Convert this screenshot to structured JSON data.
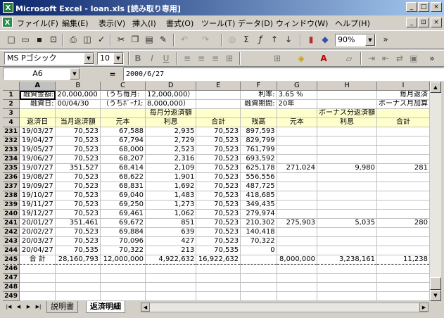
{
  "window": {
    "title": "Microsoft Excel - loan.xls  [読み取り専用]",
    "controls": [
      "_",
      "□",
      "×"
    ],
    "doc_controls": [
      "_",
      "⊡",
      "×"
    ]
  },
  "menu": [
    "ファイル(F)",
    "編集(E)",
    "表示(V)",
    "挿入(I)",
    "書式(O)",
    "ツール(T)",
    "データ(D)",
    "ウィンドウ(W)",
    "ヘルプ(H)"
  ],
  "toolbar": {
    "zoom": "90%",
    "font_name": "MS Pゴシック",
    "font_size": "10"
  },
  "formula": {
    "name_box": "A6",
    "equals": "=",
    "content": "2000/6/27"
  },
  "columns": [
    "",
    "A",
    "B",
    "C",
    "D",
    "E",
    "F",
    "G",
    "H",
    "I"
  ],
  "rows": [
    {
      "n": "1",
      "cells": [
        "融資金額:",
        "20,000,000",
        "（うち毎月:",
        "12,000,000）",
        "",
        "利率:",
        "3.65 %",
        "",
        "毎月返済"
      ]
    },
    {
      "n": "2",
      "cells": [
        "融資日:",
        "00/04/30",
        "（うちﾎﾞｰﾅｽ:",
        "8,000,000）",
        "",
        "融資期間:",
        "20年",
        "",
        "ボーナス月加算"
      ]
    },
    {
      "n": "3",
      "cells": [
        "",
        "",
        "",
        "毎月分返済額",
        "",
        "",
        "",
        "ボーナス分返済額",
        ""
      ]
    },
    {
      "n": "4",
      "cells": [
        "返済日",
        "当月返済額",
        "元本",
        "利息",
        "合計",
        "残高",
        "元本",
        "利息",
        "合計"
      ]
    },
    {
      "n": "231",
      "cells": [
        "19/03/27",
        "70,523",
        "67,588",
        "2,935",
        "70,523",
        "897,593",
        "",
        "",
        ""
      ]
    },
    {
      "n": "232",
      "cells": [
        "19/04/27",
        "70,523",
        "67,794",
        "2,729",
        "70,523",
        "829,799",
        "",
        "",
        ""
      ]
    },
    {
      "n": "233",
      "cells": [
        "19/05/27",
        "70,523",
        "68,000",
        "2,523",
        "70,523",
        "761,799",
        "",
        "",
        ""
      ]
    },
    {
      "n": "234",
      "cells": [
        "19/06/27",
        "70,523",
        "68,207",
        "2,316",
        "70,523",
        "693,592",
        "",
        "",
        ""
      ]
    },
    {
      "n": "235",
      "cells": [
        "19/07/27",
        "351,527",
        "68,414",
        "2,109",
        "70,523",
        "625,178",
        "271,024",
        "9,980",
        "281"
      ]
    },
    {
      "n": "236",
      "cells": [
        "19/08/27",
        "70,523",
        "68,622",
        "1,901",
        "70,523",
        "556,556",
        "",
        "",
        ""
      ]
    },
    {
      "n": "237",
      "cells": [
        "19/09/27",
        "70,523",
        "68,831",
        "1,692",
        "70,523",
        "487,725",
        "",
        "",
        ""
      ]
    },
    {
      "n": "238",
      "cells": [
        "19/10/27",
        "70,523",
        "69,040",
        "1,483",
        "70,523",
        "418,685",
        "",
        "",
        ""
      ]
    },
    {
      "n": "239",
      "cells": [
        "19/11/27",
        "70,523",
        "69,250",
        "1,273",
        "70,523",
        "349,435",
        "",
        "",
        ""
      ]
    },
    {
      "n": "240",
      "cells": [
        "19/12/27",
        "70,523",
        "69,461",
        "1,062",
        "70,523",
        "279,974",
        "",
        "",
        ""
      ]
    },
    {
      "n": "241",
      "cells": [
        "20/01/27",
        "351,461",
        "69,672",
        "851",
        "70,523",
        "210,302",
        "275,903",
        "5,035",
        "280"
      ]
    },
    {
      "n": "242",
      "cells": [
        "20/02/27",
        "70,523",
        "69,884",
        "639",
        "70,523",
        "140,418",
        "",
        "",
        ""
      ]
    },
    {
      "n": "243",
      "cells": [
        "20/03/27",
        "70,523",
        "70,096",
        "427",
        "70,523",
        "70,322",
        "",
        "",
        ""
      ]
    },
    {
      "n": "244",
      "cells": [
        "20/04/27",
        "70,535",
        "70,322",
        "213",
        "70,535",
        "0",
        "",
        "",
        ""
      ]
    },
    {
      "n": "245",
      "cells": [
        "合 計",
        "28,160,793",
        "12,000,000",
        "4,922,632",
        "16,922,632",
        "",
        "8,000,000",
        "3,238,161",
        "11,238"
      ]
    },
    {
      "n": "246",
      "cells": [
        "",
        "",
        "",
        "",
        "",
        "",
        "",
        "",
        ""
      ]
    },
    {
      "n": "247",
      "cells": [
        "",
        "",
        "",
        "",
        "",
        "",
        "",
        "",
        ""
      ]
    },
    {
      "n": "248",
      "cells": [
        "",
        "",
        "",
        "",
        "",
        "",
        "",
        "",
        ""
      ]
    },
    {
      "n": "249",
      "cells": [
        "",
        "",
        "",
        "",
        "",
        "",
        "",
        "",
        ""
      ]
    }
  ],
  "sheets": [
    "説明書",
    "返済明細"
  ],
  "active_sheet": "返済明細"
}
